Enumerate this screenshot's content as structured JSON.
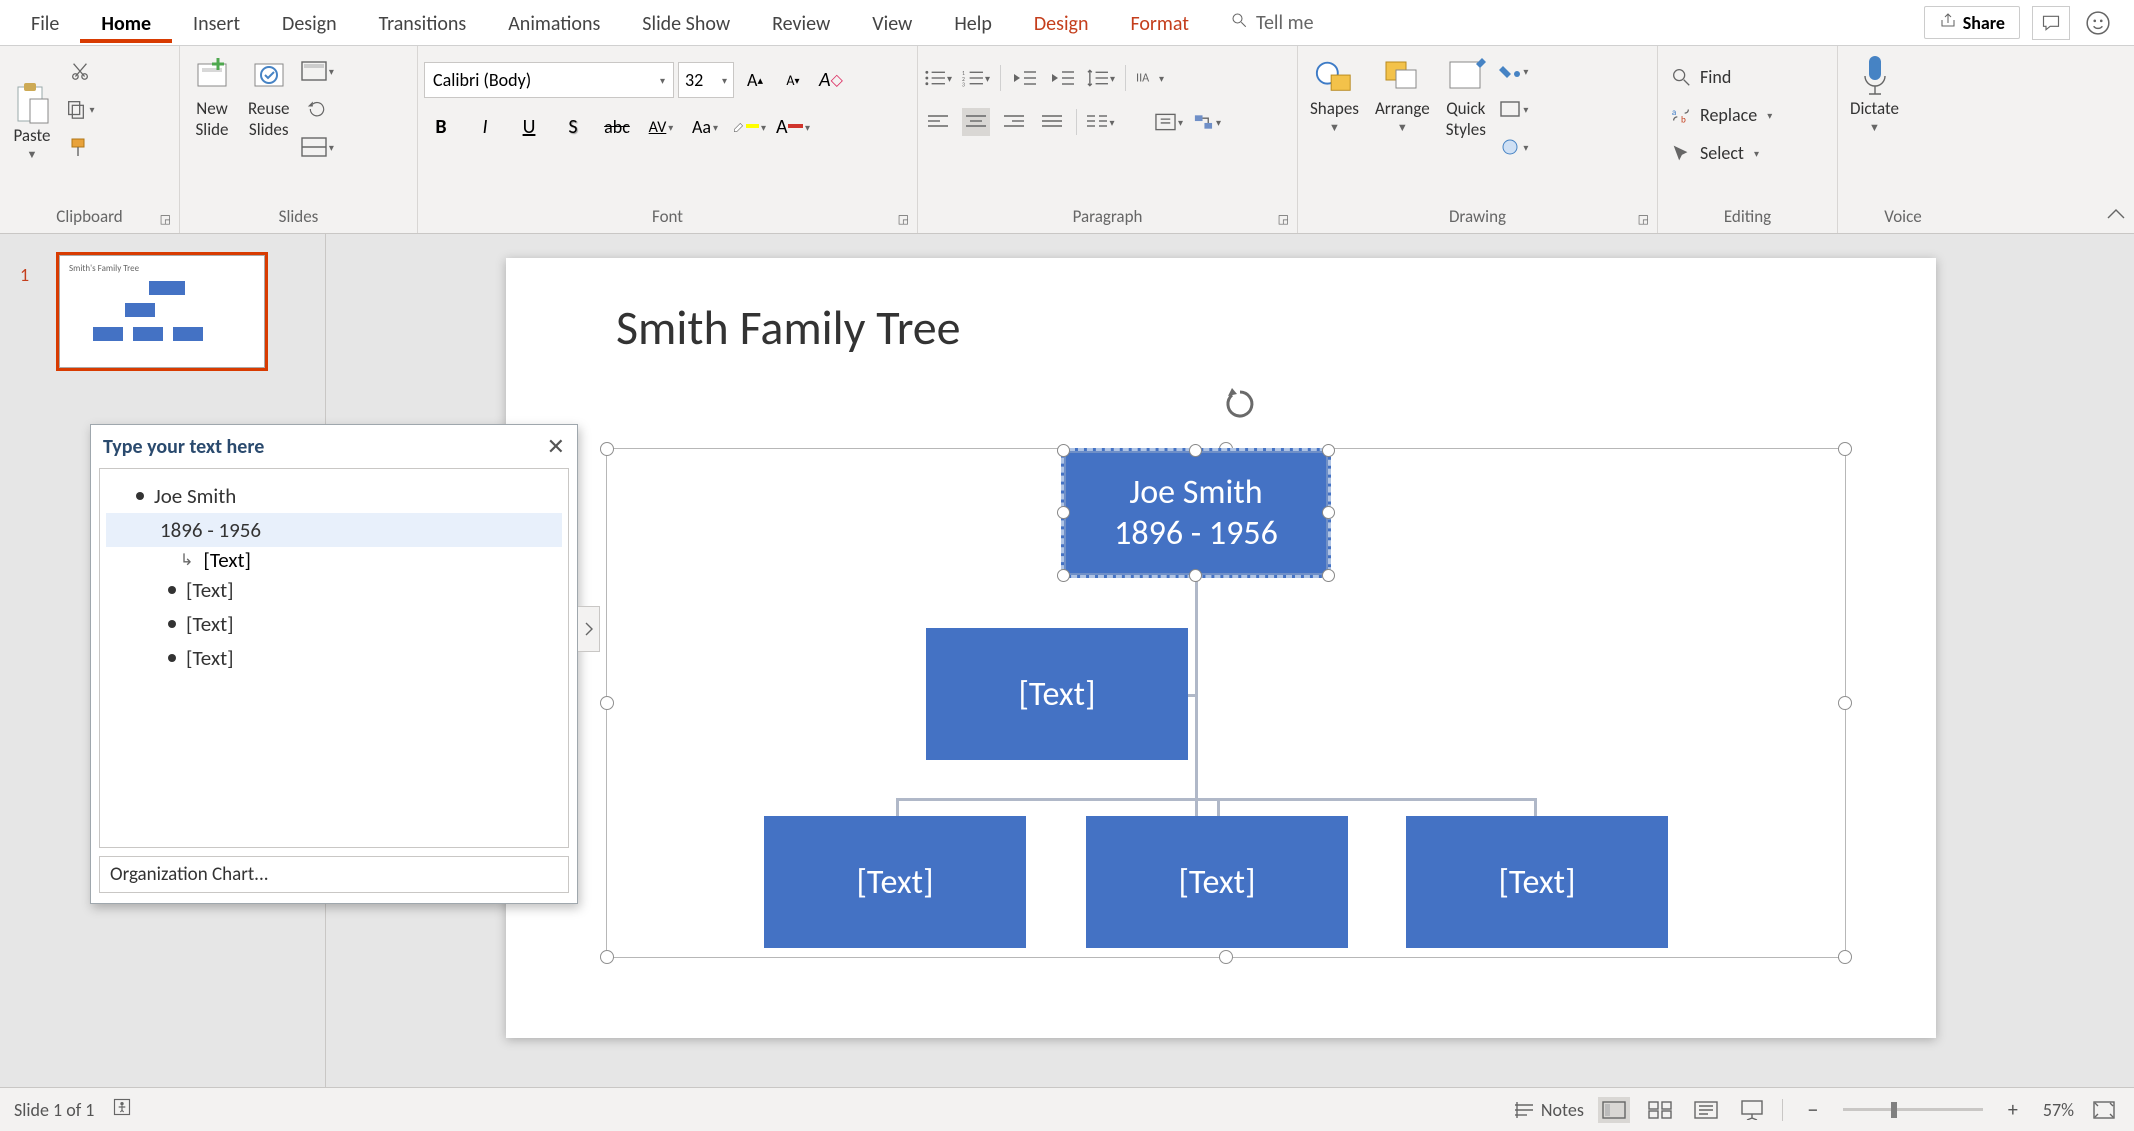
{
  "tabs": {
    "file": "File",
    "home": "Home",
    "insert": "Insert",
    "design": "Design",
    "transitions": "Transitions",
    "animations": "Animations",
    "slideshow": "Slide Show",
    "review": "Review",
    "view": "View",
    "help": "Help",
    "ctx_design": "Design",
    "ctx_format": "Format",
    "tellme": "Tell me",
    "share": "Share"
  },
  "ribbon": {
    "clipboard": {
      "paste": "Paste",
      "label": "Clipboard"
    },
    "slides": {
      "new_slide": "New\nSlide",
      "reuse_slides": "Reuse\nSlides",
      "label": "Slides"
    },
    "font": {
      "name": "Calibri (Body)",
      "size": "32",
      "label": "Font"
    },
    "paragraph": {
      "label": "Paragraph"
    },
    "drawing": {
      "shapes": "Shapes",
      "arrange": "Arrange",
      "quick_styles": "Quick\nStyles",
      "label": "Drawing"
    },
    "editing": {
      "find": "Find",
      "replace": "Replace",
      "select": "Select",
      "label": "Editing"
    },
    "voice": {
      "dictate": "Dictate",
      "label": "Voice"
    }
  },
  "thumbnail": {
    "num": "1",
    "mini_title": "Smith's Family Tree"
  },
  "textpane": {
    "title": "Type your text here",
    "items": {
      "root_name": "Joe Smith",
      "root_dates": "1896 - 1956",
      "placeholder": "[Text]"
    },
    "footer": "Organization Chart..."
  },
  "slide": {
    "title": "Smith Family Tree",
    "root_name": "Joe Smith",
    "root_dates": "1896 - 1956",
    "placeholder": "[Text]"
  },
  "status": {
    "slide_info": "Slide 1 of 1",
    "notes": "Notes",
    "zoom": "57%"
  },
  "colors": {
    "accent": "#d83b01",
    "shape": "#4472c4"
  }
}
